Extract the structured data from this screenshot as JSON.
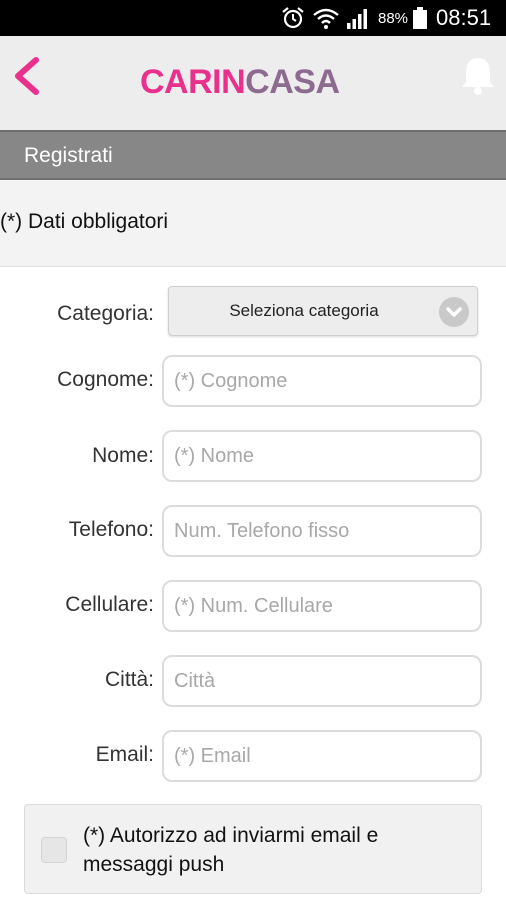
{
  "status_bar": {
    "battery_percent": "88%",
    "time": "08:51",
    "icons": [
      "alarm-icon",
      "wifi-icon",
      "signal-icon",
      "battery-icon"
    ]
  },
  "app_bar": {
    "logo_part1": "CARIN",
    "logo_part2": "CASA",
    "icons": [
      "back-arrow-icon",
      "bell-icon"
    ],
    "colors": {
      "brand_pink": "#e8308c",
      "brand_purple": "#8d6a8f"
    }
  },
  "section": {
    "title": "Registrati"
  },
  "form": {
    "required_note": "(*) Dati obbligatori",
    "category_label": "Categoria:",
    "category_select": "Seleziona categoria",
    "fields": {
      "cognome": {
        "label": "Cognome:",
        "placeholder": "(*) Cognome"
      },
      "nome": {
        "label": "Nome:",
        "placeholder": "(*) Nome"
      },
      "telefono": {
        "label": "Telefono:",
        "placeholder": "Num. Telefono fisso"
      },
      "cellulare": {
        "label": "Cellulare:",
        "placeholder": "(*) Num. Cellulare"
      },
      "citta": {
        "label": "Città:",
        "placeholder": "Città"
      },
      "email": {
        "label": "Email:",
        "placeholder": "(*) Email"
      }
    },
    "consent_text": "(*) Autorizzo ad inviarmi email e messaggi push",
    "consent_checked": false
  }
}
